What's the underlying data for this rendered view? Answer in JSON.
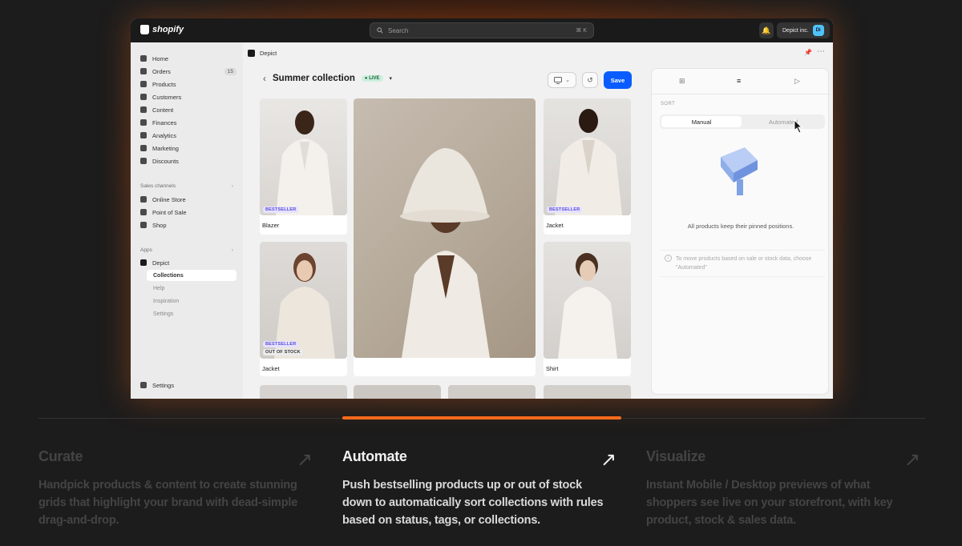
{
  "topbar": {
    "brand": "shopify",
    "search_placeholder": "Search",
    "search_shortcut": "⌘ K",
    "store_name": "Depict inc.",
    "store_avatar": "Di"
  },
  "sidebar": {
    "items": [
      {
        "label": "Home",
        "icon": "home-icon"
      },
      {
        "label": "Orders",
        "icon": "orders-icon",
        "badge": "15"
      },
      {
        "label": "Products",
        "icon": "tag-icon"
      },
      {
        "label": "Customers",
        "icon": "person-icon"
      },
      {
        "label": "Content",
        "icon": "content-icon"
      },
      {
        "label": "Finances",
        "icon": "bank-icon"
      },
      {
        "label": "Analytics",
        "icon": "chart-icon"
      },
      {
        "label": "Marketing",
        "icon": "target-icon"
      },
      {
        "label": "Discounts",
        "icon": "discount-icon"
      }
    ],
    "sales_channels_label": "Sales channels",
    "sales_channels": [
      {
        "label": "Online Store",
        "icon": "store-icon"
      },
      {
        "label": "Point of Sale",
        "icon": "pos-icon"
      },
      {
        "label": "Shop",
        "icon": "shop-icon"
      }
    ],
    "apps_label": "Apps",
    "app_name": "Depict",
    "app_sub": [
      "Collections",
      "Help",
      "Inspiration",
      "Settings"
    ],
    "settings_label": "Settings"
  },
  "app_header": {
    "name": "Depict"
  },
  "page": {
    "title": "Summer collection",
    "status": "LIVE",
    "save_label": "Save"
  },
  "products": [
    {
      "label": "Blazer",
      "tags": [
        "BESTSELLER"
      ]
    },
    {
      "label": "Jacket",
      "tags": [
        "BESTSELLER"
      ]
    },
    {
      "label": "Jacket",
      "tags": [
        "BESTSELLER",
        "OUT OF STOCK"
      ]
    },
    {
      "label": "Shirt",
      "tags": []
    }
  ],
  "panel": {
    "sort_label": "SORT",
    "sort_options": [
      "Manual",
      "Automated"
    ],
    "selected": "Manual",
    "message": "All products keep their pinned positions.",
    "note": "To move products based on sale or stock data, choose \"Automated\""
  },
  "features": [
    {
      "title": "Curate",
      "text": "Handpick products & content to create stunning grids that highlight your brand with dead-simple drag-and-drop.",
      "active": false
    },
    {
      "title": "Automate",
      "text": "Push bestselling products up or out of stock down to automatically sort collections with rules based on status, tags, or collections.",
      "active": true
    },
    {
      "title": "Visualize",
      "text": "Instant Mobile / Desktop previews of what shoppers see live on your storefront, with key product, stock & sales data.",
      "active": false
    }
  ],
  "colors": {
    "accent": "#ff6a1a",
    "save_button": "#0a5cff",
    "background": "#1c1c1c"
  }
}
